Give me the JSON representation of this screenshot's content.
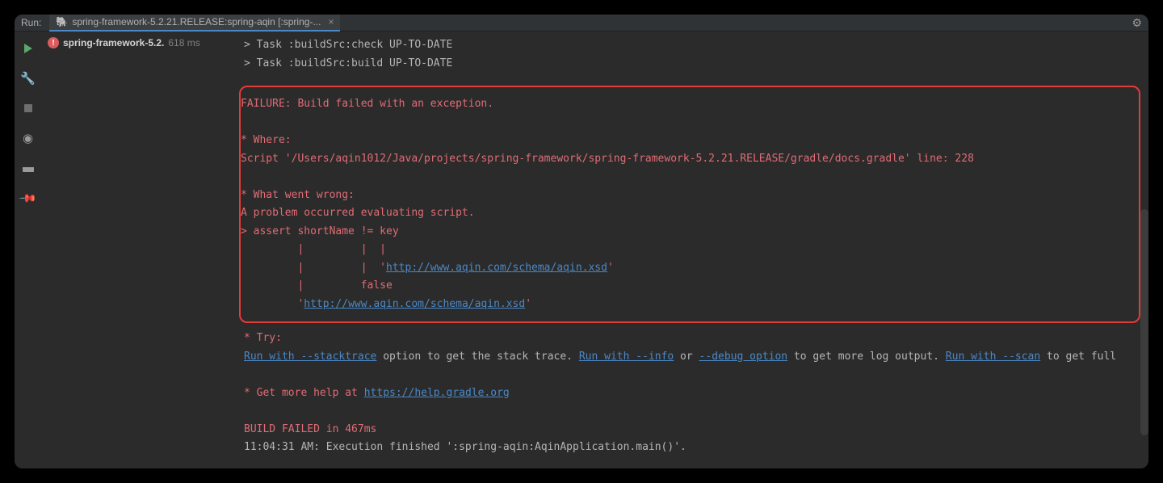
{
  "tabBar": {
    "label": "Run:",
    "tabTitle": "spring-framework-5.2.21.RELEASE:spring-aqin [:spring-..."
  },
  "sidePanel": {
    "taskName": "spring-framework-5.2.",
    "taskTime": "618 ms"
  },
  "console": {
    "preLines": [
      "> Task :buildSrc:check UP-TO-DATE",
      "> Task :buildSrc:build UP-TO-DATE"
    ],
    "error": {
      "failure": "FAILURE: Build failed with an exception.",
      "whereHeader": "* Where:",
      "whereBody": "Script '/Users/aqin1012/Java/projects/spring-framework/spring-framework-5.2.21.RELEASE/gradle/docs.gradle' line: 228",
      "wrongHeader": "* What went wrong:",
      "wrongBody": "A problem occurred evaluating script.",
      "assertLine": "> assert shortName != key",
      "pipes1": "         |         |  |",
      "pipes2a": "         |         |  '",
      "url1": "http://www.aqin.com/schema/aqin.xsd",
      "pipes2b": "'",
      "pipes3": "         |         false",
      "pipes4a": "         '",
      "url2": "http://www.aqin.com/schema/aqin.xsd",
      "pipes4b": "'"
    },
    "try": {
      "header": "* Try:",
      "p1": "Run with --stacktrace",
      "t1": " option to get the stack trace. ",
      "p2": "Run with --info",
      "t2": " or ",
      "p3": "--debug option",
      "t3": " to get more log output. ",
      "p4": "Run with --scan",
      "t4": " to get full"
    },
    "help": {
      "text": "* Get more help at ",
      "link": "https://help.gradle.org"
    },
    "buildFailed": "BUILD FAILED in 467ms",
    "finished": "11:04:31 AM: Execution finished ':spring-aqin:AqinApplication.main()'."
  }
}
